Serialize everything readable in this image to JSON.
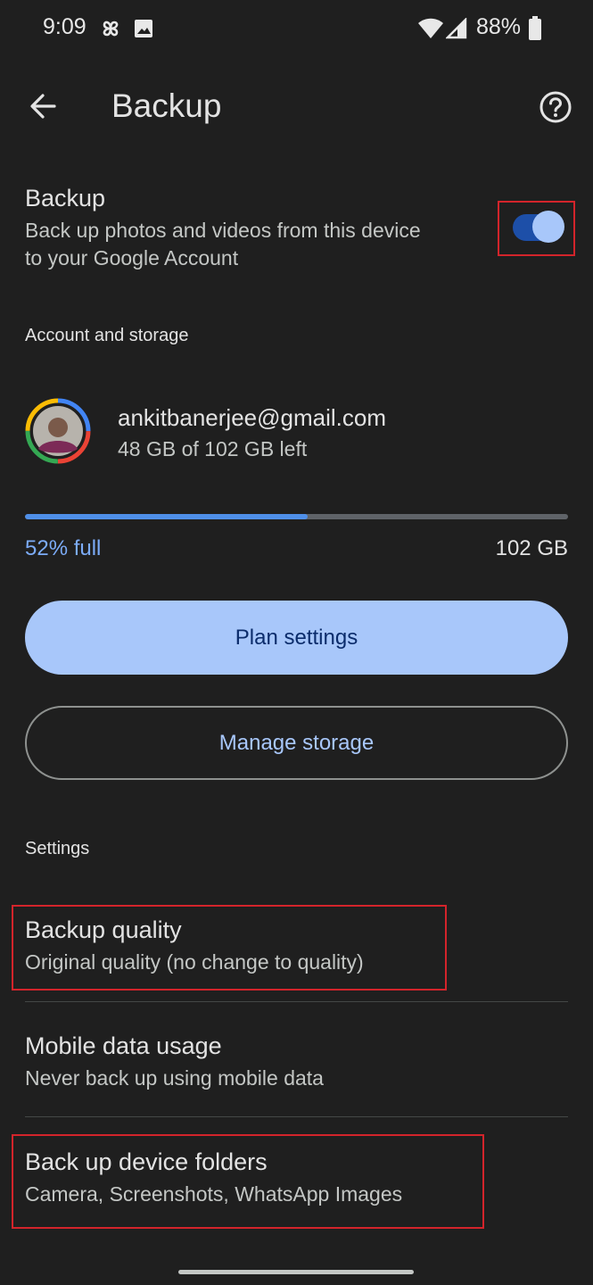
{
  "status_bar": {
    "time": "9:09",
    "battery_percent": "88%",
    "icons": [
      "pinwheel-icon",
      "image-icon",
      "wifi-icon",
      "signal-icon",
      "battery-icon"
    ]
  },
  "app_bar": {
    "title": "Backup",
    "back_icon": "arrow-back-icon",
    "help_icon": "help-circle-icon"
  },
  "backup_toggle": {
    "title": "Backup",
    "subtitle_line1": "Back up photos and videos from this device",
    "subtitle_line2": "to your Google Account",
    "enabled": true
  },
  "account": {
    "section_label": "Account and storage",
    "email": "ankitbanerjee@gmail.com",
    "storage_left": "48 GB of 102 GB left",
    "usage_fraction": 0.52,
    "usage_label": "52% full",
    "total": "102 GB"
  },
  "buttons": {
    "plan_settings": "Plan settings",
    "manage_storage": "Manage storage"
  },
  "settings": {
    "section_label": "Settings",
    "items": [
      {
        "title": "Backup quality",
        "subtitle": "Original quality (no change to quality)"
      },
      {
        "title": "Mobile data usage",
        "subtitle": "Never back up using mobile data"
      },
      {
        "title": "Back up device folders",
        "subtitle": "Camera, Screenshots, WhatsApp Images"
      }
    ]
  },
  "colors": {
    "background": "#1f1f1f",
    "accent": "#a8c7fa",
    "highlight": "#d3242b"
  }
}
